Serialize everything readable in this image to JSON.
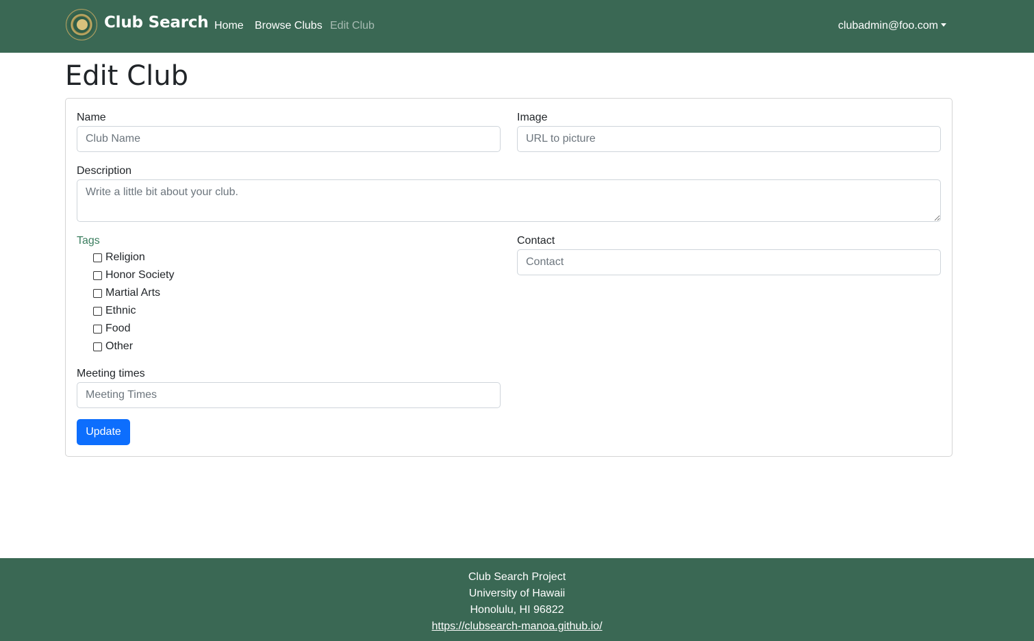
{
  "navbar": {
    "brand": "Club Search",
    "logo_icon": "university-seal-icon",
    "links": [
      "Home",
      "Browse Clubs",
      "Edit Club"
    ],
    "active_link": "Edit Club",
    "user": "clubadmin@foo.com",
    "background": "#3a6854"
  },
  "page": {
    "title": "Edit Club"
  },
  "form": {
    "name_label": "Name",
    "name_placeholder": "Club Name",
    "image_label": "Image",
    "image_placeholder": "URL to picture",
    "description_label": "Description",
    "description_placeholder": "Write a little bit about your club.",
    "tags_label": "Tags",
    "tags": [
      "Religion",
      "Honor Society",
      "Martial Arts",
      "Ethnic",
      "Food",
      "Other"
    ],
    "contact_label": "Contact",
    "contact_placeholder": "Contact",
    "meeting_label": "Meeting times",
    "meeting_placeholder": "Meeting Times",
    "submit_label": "Update",
    "submit_color": "#0d6efd"
  },
  "footer": {
    "line1": "Club Search Project",
    "line2": "University of Hawaii",
    "line3": "Honolulu, HI 96822",
    "link": "https://clubsearch-manoa.github.io/"
  }
}
